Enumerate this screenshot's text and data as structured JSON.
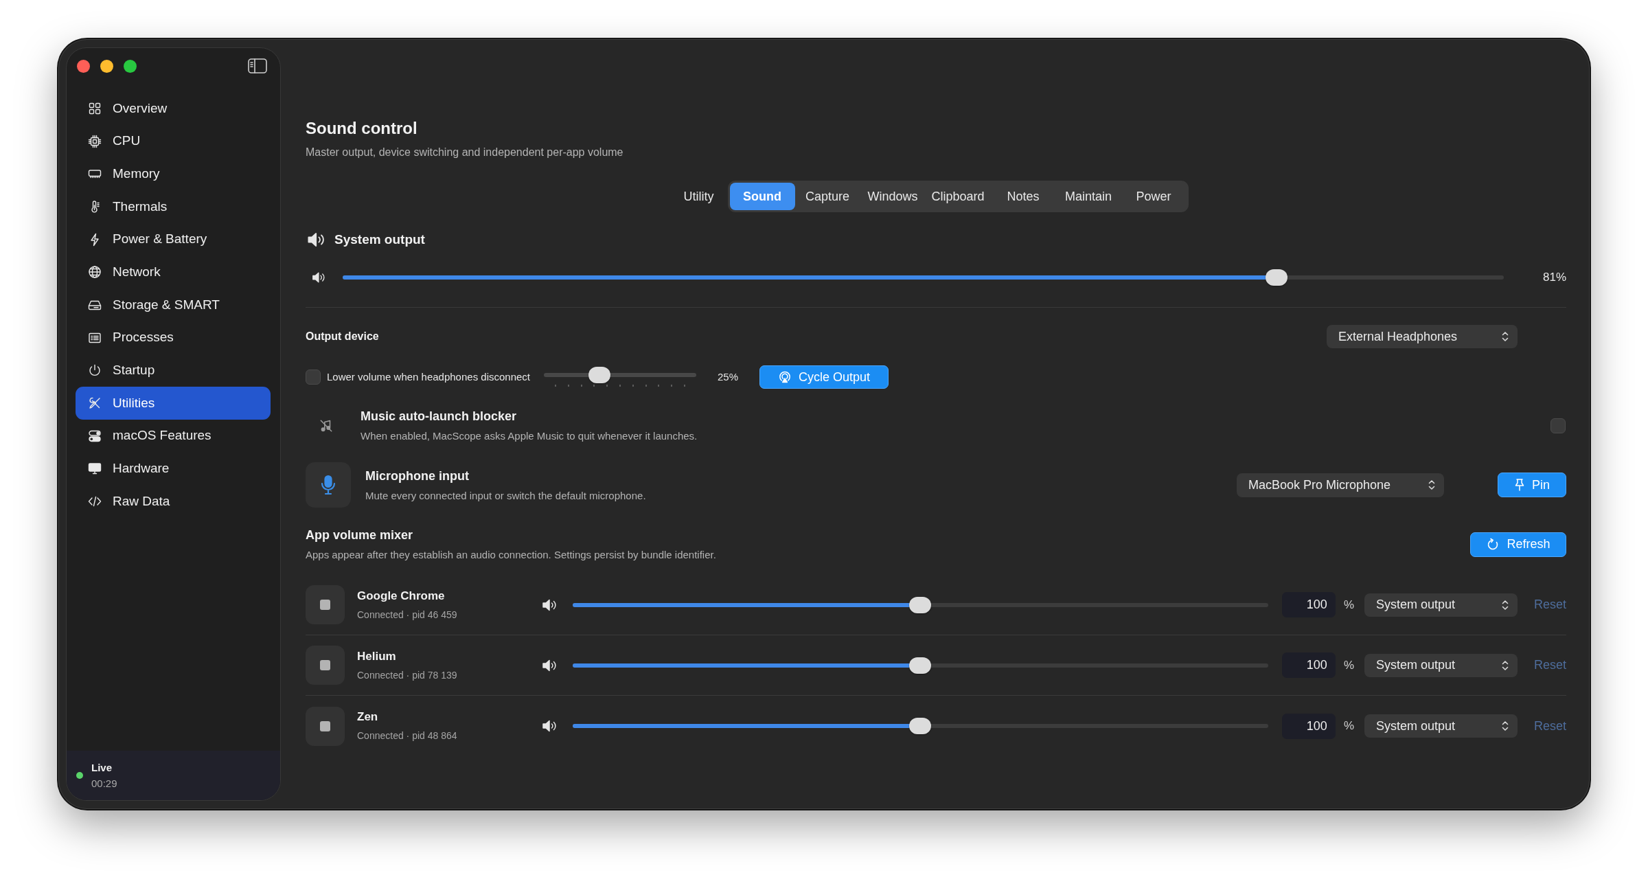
{
  "sidebar": {
    "items": [
      {
        "label": "Overview",
        "selected": false
      },
      {
        "label": "CPU",
        "selected": false
      },
      {
        "label": "Memory",
        "selected": false
      },
      {
        "label": "Thermals",
        "selected": false
      },
      {
        "label": "Power & Battery",
        "selected": false
      },
      {
        "label": "Network",
        "selected": false
      },
      {
        "label": "Storage & SMART",
        "selected": false
      },
      {
        "label": "Processes",
        "selected": false
      },
      {
        "label": "Startup",
        "selected": false
      },
      {
        "label": "Utilities",
        "selected": true
      },
      {
        "label": "macOS Features",
        "selected": false
      },
      {
        "label": "Hardware",
        "selected": false
      },
      {
        "label": "Raw Data",
        "selected": false
      }
    ],
    "status": {
      "label": "Live",
      "time": "00:29"
    }
  },
  "page": {
    "title": "Sound control",
    "subtitle": "Master output, device switching and independent per-app volume"
  },
  "tab_bar": {
    "label": "Utility",
    "tabs": [
      {
        "label": "Sound",
        "selected": true
      },
      {
        "label": "Capture",
        "selected": false
      },
      {
        "label": "Windows",
        "selected": false
      },
      {
        "label": "Clipboard",
        "selected": false
      },
      {
        "label": "Notes",
        "selected": false
      },
      {
        "label": "Maintain",
        "selected": false
      },
      {
        "label": "Power",
        "selected": false
      }
    ]
  },
  "system_output": {
    "heading": "System output",
    "level": 0.81,
    "reading": "81%"
  },
  "output_device": {
    "label": "Output device",
    "device": "External Headphones",
    "lower_volume": {
      "label": "Lower volume when headphones disconnect",
      "checked": false,
      "level": 0.34,
      "reading": "25%"
    },
    "cycle_button": "Cycle Output"
  },
  "music_blocker": {
    "title": "Music auto-launch blocker",
    "description": "When enabled, MacScope asks Apple Music to quit whenever it launches.",
    "checked": false
  },
  "microphone": {
    "title": "Microphone input",
    "description": "Mute every connected input or switch the default microphone.",
    "device": "MacBook Pro Microphone",
    "pin_button": "Pin"
  },
  "mixer": {
    "title": "App volume mixer",
    "description": "Apps appear after they establish an audio connection. Settings persist by bundle identifier.",
    "refresh_button": "Refresh",
    "apps": [
      {
        "name": "Google Chrome",
        "detail": "Connected · pid 46 459",
        "level": 0.5,
        "value": "100",
        "unit": "%",
        "output": "System output",
        "reset": {
          "label": "Reset",
          "disabled": true
        }
      },
      {
        "name": "Helium",
        "detail": "Connected · pid 78 139",
        "level": 0.5,
        "value": "100",
        "unit": "%",
        "output": "System output",
        "reset": {
          "label": "Reset",
          "disabled": true
        }
      },
      {
        "name": "Zen",
        "detail": "Connected · pid 48 864",
        "level": 0.5,
        "value": "100",
        "unit": "%",
        "output": "System output",
        "reset": {
          "label": "Reset",
          "disabled": true
        }
      }
    ]
  }
}
